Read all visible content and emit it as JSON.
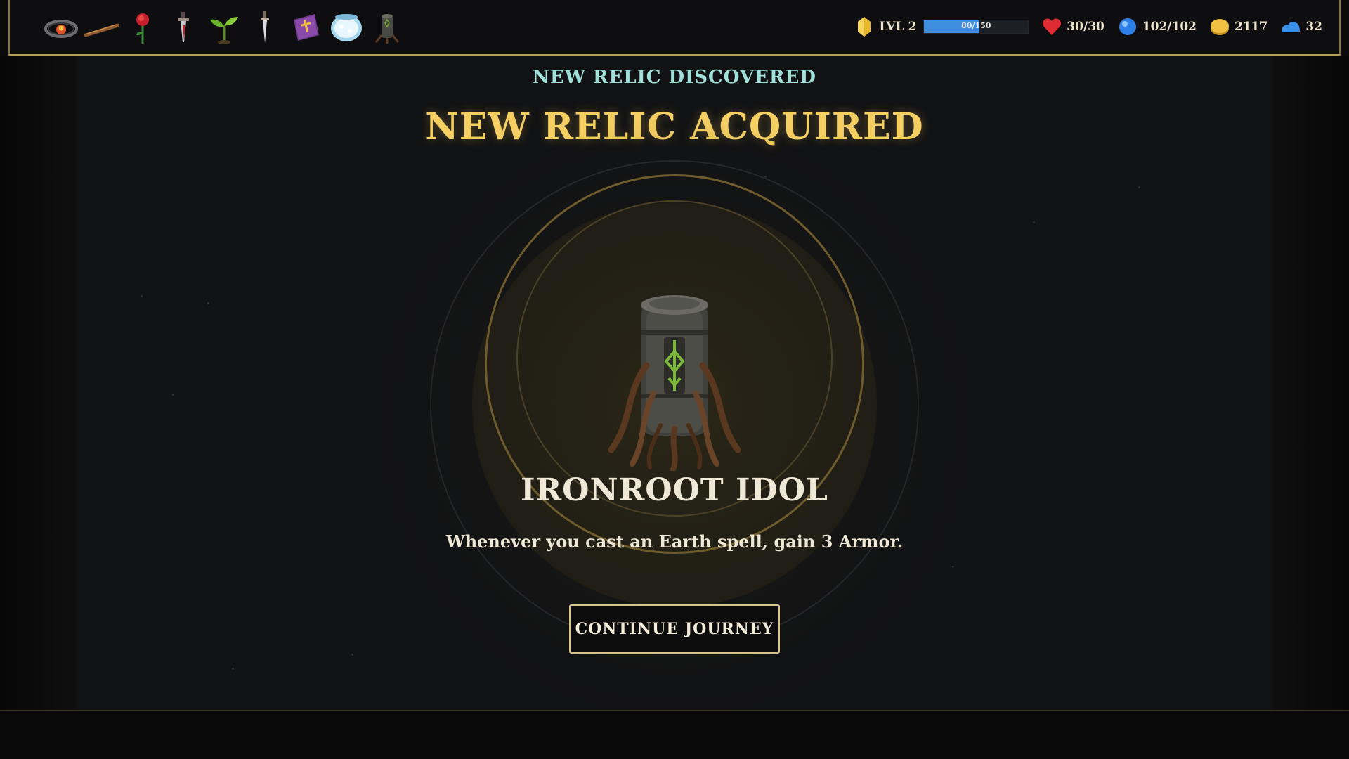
{
  "topbar": {
    "relics": [
      {
        "name": "fire-ring-icon"
      },
      {
        "name": "wooden-staff-icon"
      },
      {
        "name": "red-rose-icon"
      },
      {
        "name": "bloody-dagger-icon"
      },
      {
        "name": "sprout-icon"
      },
      {
        "name": "silver-dagger-icon"
      },
      {
        "name": "holy-book-icon"
      },
      {
        "name": "frost-jar-icon"
      },
      {
        "name": "ironroot-idol-icon"
      }
    ],
    "level": {
      "label": "LVL 2",
      "xp_text": "80/150",
      "xp_fraction": 0.533,
      "icon": "gold-crystal-icon",
      "bar_color": "#3f8fe0"
    },
    "health": {
      "value": "30/30",
      "icon": "heart-icon",
      "color": "#e02a34"
    },
    "mana": {
      "value": "102/102",
      "icon": "blue-orb-icon",
      "color": "#2f7fe8"
    },
    "gold": {
      "value": "2117",
      "icon": "gold-coin-icon",
      "color": "#e8b62a"
    },
    "cloud": {
      "value": "32",
      "icon": "cloud-icon",
      "color": "#3a8fe8"
    }
  },
  "reward": {
    "subtitle": "NEW RELIC DISCOVERED",
    "title": "NEW RELIC ACQUIRED",
    "relic_icon": "ironroot-idol-icon",
    "relic_name": "IRONROOT IDOL",
    "relic_description": "Whenever you cast an Earth spell, gain 3 Armor.",
    "continue_label": "CONTINUE JOURNEY"
  },
  "colors": {
    "title": "#f5cf62",
    "subtitle": "#9fe0d8",
    "frame_gold": "#b59a60"
  }
}
